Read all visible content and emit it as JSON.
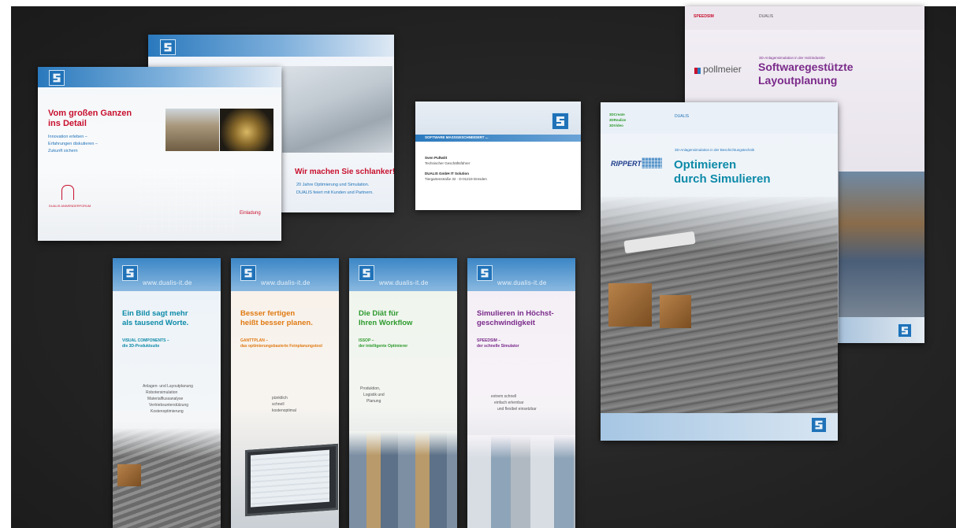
{
  "brand": {
    "domain": "www.dualis-it.de",
    "short": "DUALIS"
  },
  "colors": {
    "brand_blue": "#1f72b8",
    "red": "#c8102e",
    "teal": "#0c8aa8",
    "orange": "#e07a12",
    "green": "#2c9a2c",
    "purple": "#7a2a8a"
  },
  "flyer_invite": {
    "title_line1": "Vom großen Ganzen",
    "title_line2": "ins Detail",
    "tag1": "Innovation erleben –",
    "tag2": "Erfahrungen diskutieren –",
    "tag3": "Zukunft sichern",
    "event": "DUALIS ANWENDERFORUM",
    "label": "Einladung"
  },
  "flyer_schlank": {
    "headline": "Wir machen Sie schlanker!",
    "line1": "20 Jahre Optimierung und Simulation.",
    "line2": "DUALIS feiert mit Kunden und Partnern."
  },
  "business_card": {
    "band": "SOFTWARE MASSGESCHNEIDERT ...",
    "name": "Sven Pultwitt",
    "title": "Technischer Geschäftsführer",
    "company": "DUALIS GmbH IT Solution",
    "addr": "Tiergartenstraße 32 · D-01219 Dresden"
  },
  "brochure_pollmeier": {
    "top_left": "SPEEDSIM",
    "top_right": "DUALIS",
    "subtitle": "3D-Anlagensimulation in der Holzindustrie",
    "client": "pollmeier",
    "title_line1": "Softwaregestützte",
    "title_line2": "Layoutplanung"
  },
  "brochure_rippert": {
    "products": [
      "3DCreate",
      "3DRealize",
      "3DVideo"
    ],
    "top_right": "DUALIS",
    "subtitle": "3D-Anlagensimulation in der Beschichtungstechnik",
    "client": "RIPPERT",
    "title_line1": "Optimieren",
    "title_line2": "durch Simulieren"
  },
  "rollups": [
    {
      "title1": "Ein Bild sagt mehr",
      "title2": "als tausend Worte.",
      "sub1": "VISUAL COMPONENTS –",
      "sub2": "die 3D-Produktsuite",
      "bullets": [
        "Anlagen- und Layoutplanung",
        "Robotersimulation",
        "Materialflussanalyse",
        "Vertriebsunterstützung",
        "Kostenoptimierung"
      ]
    },
    {
      "title1": "Besser fertigen",
      "title2": "heißt besser planen.",
      "sub1": "GANTTPLAN –",
      "sub2": "das optimierungsbasierte Feinplanungstool",
      "bullets": [
        "pünktlich",
        "schnell",
        "kostenoptimal"
      ]
    },
    {
      "title1": "Die Diät für",
      "title2": "Ihren Workflow",
      "sub1": "ISSOP –",
      "sub2": "der intelligente Optimierer",
      "bullets": [
        "Produktion,",
        "Logistik und",
        "Planung"
      ]
    },
    {
      "title1": "Simulieren in Höchst-",
      "title2": "geschwindigkeit",
      "sub1": "SPEEDSIM –",
      "sub2": "der schnelle Simulator",
      "bullets": [
        "extrem schnell",
        "einfach erlernbar",
        "und flexibel einsetzbar"
      ]
    }
  ]
}
